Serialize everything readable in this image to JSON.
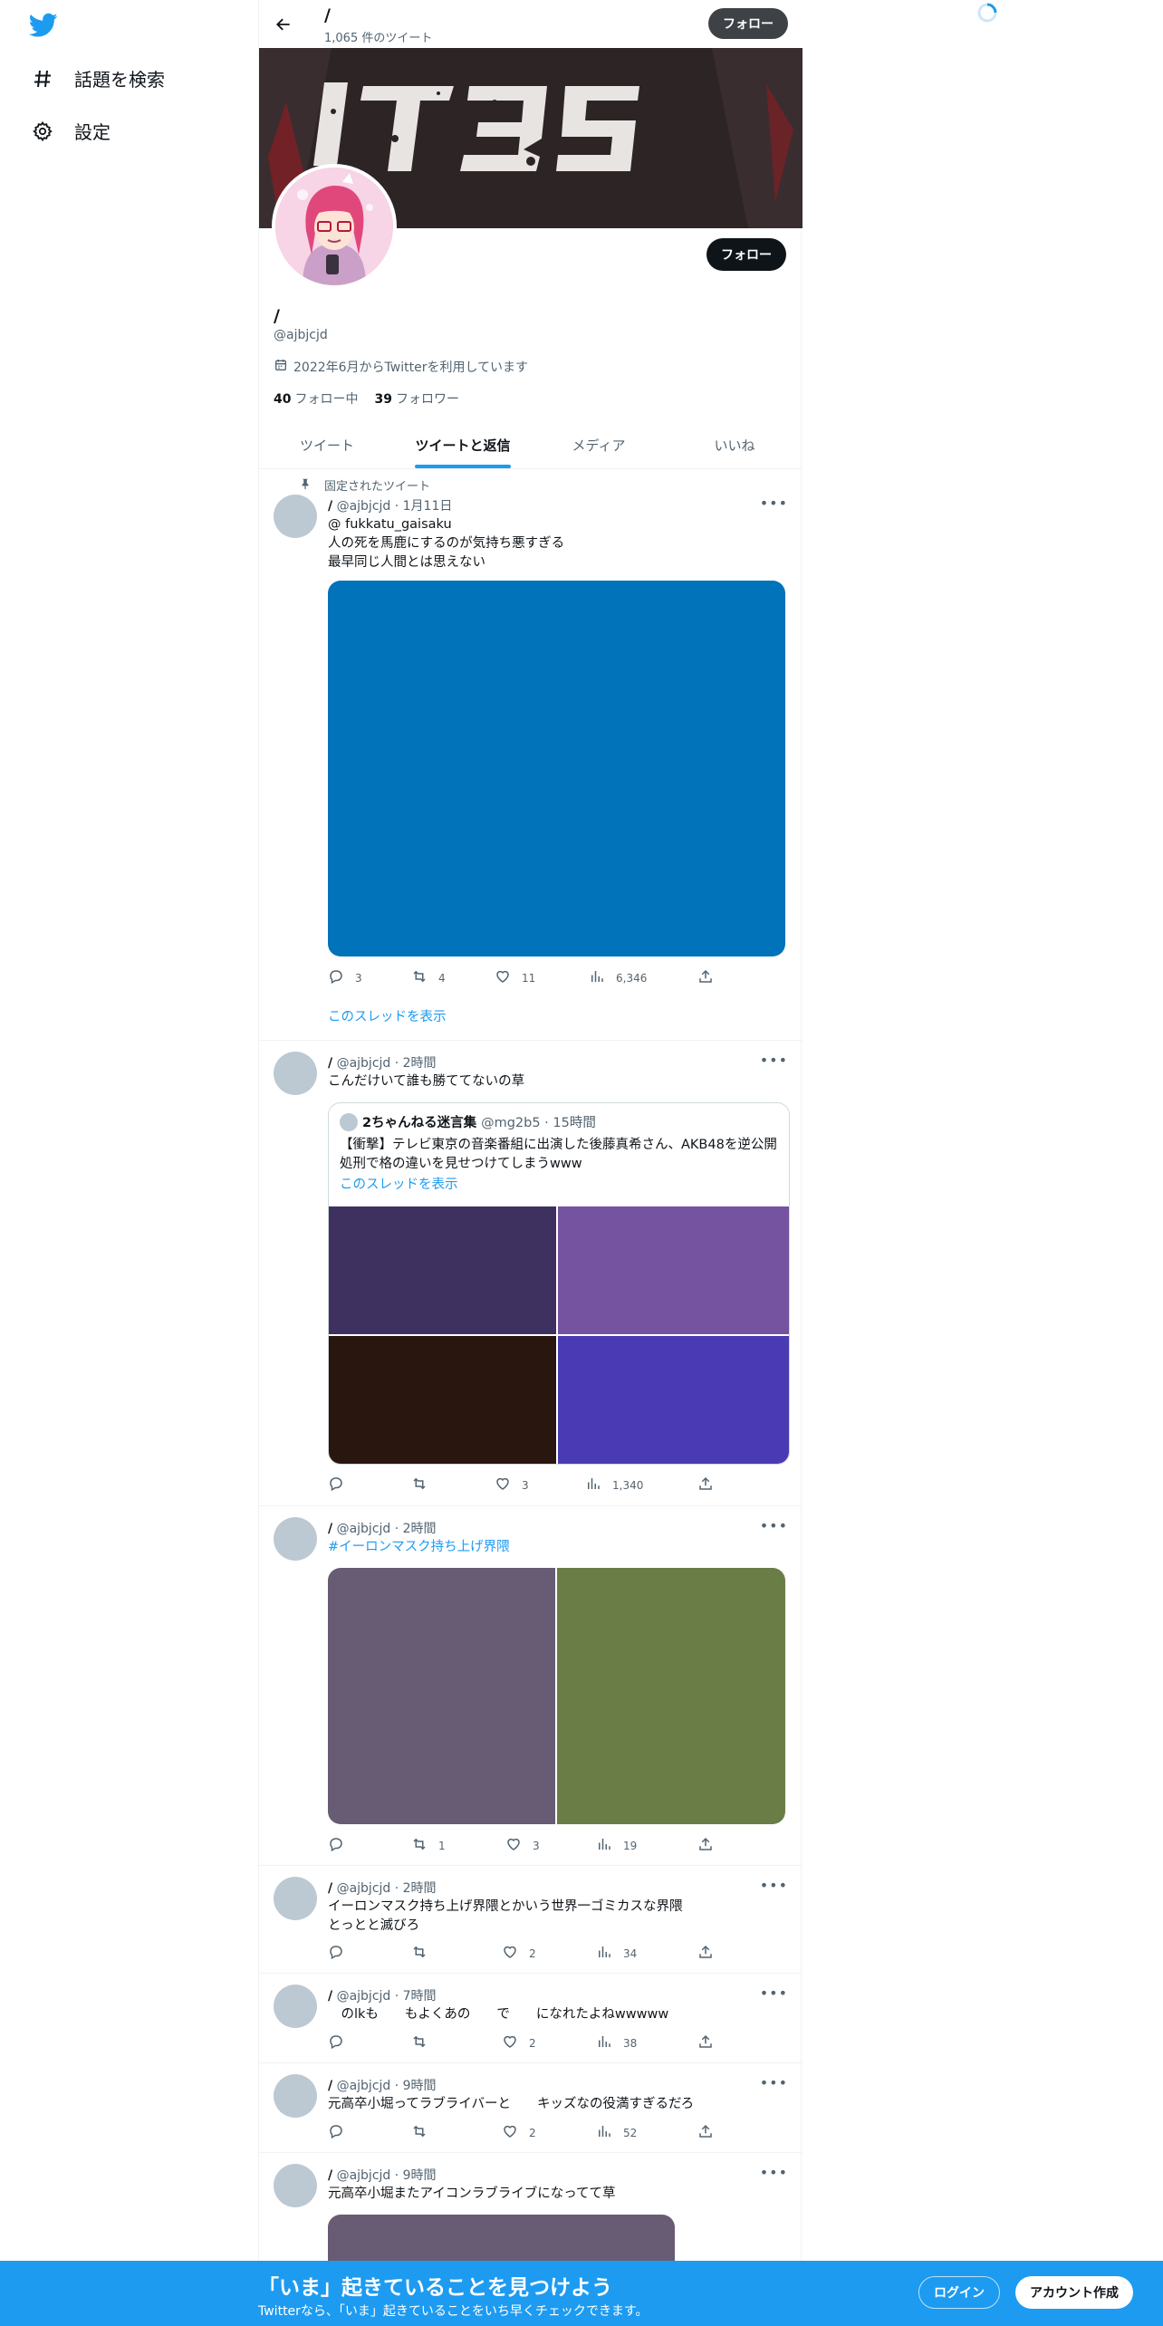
{
  "nav": {
    "logo": "twitter-bird-icon",
    "items": [
      {
        "label": "話題を検索",
        "icon": "hashtag-icon"
      },
      {
        "label": "設定",
        "icon": "gear-icon"
      }
    ]
  },
  "topbar": {
    "name": "/",
    "tweet_count": "1,065 件のツイート",
    "follow_label": "フォロー"
  },
  "banner": {
    "text": "1735",
    "colors": {
      "bg": "#2d2426",
      "letters": "#e8e4e2",
      "accent": "#8a1c22"
    }
  },
  "profile": {
    "name": "/",
    "handle": "@ajbjcjd",
    "joined": "2022年6月からTwitterを利用しています",
    "following_count": "40",
    "following_label": "フォロー中",
    "followers_count": "39",
    "followers_label": "フォロワー",
    "follow_label": "フォロー"
  },
  "tabs": [
    {
      "label": "ツイート",
      "active": false
    },
    {
      "label": "ツイートと返信",
      "active": true
    },
    {
      "label": "メディア",
      "active": false
    },
    {
      "label": "いいね",
      "active": false
    }
  ],
  "tweets": [
    {
      "pinned_label": "固定されたツイート",
      "name": "/",
      "meta": "@ajbjcjd · 1月11日",
      "lines": [
        "@ fukkatu_gaisaku",
        "人の死を馬鹿にするのが気持ち悪すぎる",
        "最早同じ人間とは思えない"
      ],
      "media_color": "#0073ba",
      "actions": {
        "reply": "3",
        "retweet": "4",
        "like": "11",
        "views": "6,346"
      },
      "thread_link": "このスレッドを表示"
    },
    {
      "name": "/",
      "meta": "@ajbjcjd · 2時間",
      "lines": [
        "こんだけいて誰も勝ててないの草"
      ],
      "quote": {
        "name": "2ちゃんねる迷言集",
        "meta": "@mg2b5 · 15時間",
        "text": "【衝撃】テレビ東京の音楽番組に出演した後藤真希さん、AKB48を逆公開処刑で格の違いを見せつけてしまうwww",
        "link": "このスレッドを表示",
        "media_colors": [
          "#3e3160",
          "#7653a0",
          "#28160f",
          "#4a3ab4"
        ]
      },
      "actions": {
        "reply": "",
        "retweet": "",
        "like": "3",
        "views": "1,340"
      }
    },
    {
      "name": "/",
      "meta": "@ajbjcjd · 2時間",
      "lines": [
        "#イーロンマスク持ち上げ界隈"
      ],
      "media_colors": [
        "#675c74",
        "#6b7d47"
      ],
      "actions": {
        "reply": "",
        "retweet": "1",
        "like": "3",
        "views": "19"
      }
    },
    {
      "name": "/",
      "meta": "@ajbjcjd · 2時間",
      "lines": [
        "イーロンマスク持ち上げ界隈とかいう世界一ゴミカスな界隈",
        "とっとと滅びろ"
      ],
      "actions": {
        "reply": "",
        "retweet": "",
        "like": "2",
        "views": "34"
      }
    },
    {
      "name": "/",
      "meta": "@ajbjcjd · 7時間",
      "lines": [
        "　のlkも　　もよくあの　　で　　になれたよねwwwww"
      ],
      "actions": {
        "reply": "",
        "retweet": "",
        "like": "2",
        "views": "38"
      }
    },
    {
      "name": "/",
      "meta": "@ajbjcjd · 9時間",
      "lines": [
        "元高卒小堀ってラブライバーと　　キッズなの役満すぎるだろ"
      ],
      "actions": {
        "reply": "",
        "retweet": "",
        "like": "2",
        "views": "52"
      }
    },
    {
      "name": "/",
      "meta": "@ajbjcjd · 9時間",
      "lines": [
        "元高卒小堀またアイコンラブライブになってて草"
      ],
      "media_color": "#675c74"
    }
  ],
  "bottom": {
    "title": "「いま」起きていることを見つけよう",
    "subtitle": "Twitterなら、「いま」起きていることをいち早くチェックできます。",
    "login": "ログイン",
    "signup": "アカウント作成",
    "color": "#1d9bf0"
  }
}
